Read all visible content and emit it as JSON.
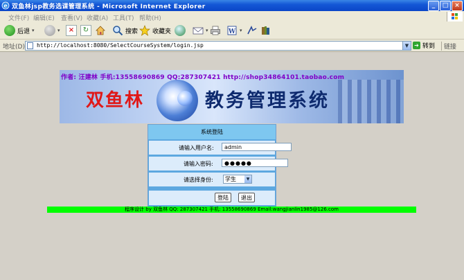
{
  "window": {
    "title": "双鱼林jsp教务选课管理系统 - Microsoft Internet Explorer"
  },
  "menu": [
    "文件(F)",
    "编辑(E)",
    "查看(V)",
    "收藏(A)",
    "工具(T)",
    "帮助(H)"
  ],
  "toolbar": {
    "back_label": "后退",
    "search_label": "搜索",
    "favorites_label": "收藏夹"
  },
  "address": {
    "label": "地址(D)",
    "url": "http://localhost:8080/SelectCourseSystem/login.jsp",
    "go_label": "转到",
    "links_label": "链接"
  },
  "banner": {
    "author_line": "作者: 汪建林  手机:13558690869 QQ:287307421 http://shop34864101.taobao.com",
    "brand": "双鱼林",
    "system_name": "教务管理系统"
  },
  "login": {
    "header": "系统登陆",
    "username_label": "请输入用户名:",
    "username_value": "admin",
    "password_label": "请输入密码:",
    "password_value": "●●●●●",
    "role_label": "请选择身份:",
    "role_value": "学生",
    "login_button": "登陆",
    "exit_button": "退出"
  },
  "footer": {
    "text": "程序设计 by 双鱼林 QQ: 287307421 手机: 13558690869 Email:wangjianlin1985@126.com"
  },
  "colors": {
    "title_bar": "#0a46c8",
    "login_header": "#7ec7f0",
    "login_row": "#dcecfb",
    "footer_bg": "#00ff00",
    "author_text": "#8000c8",
    "brand_text": "#e01818"
  }
}
